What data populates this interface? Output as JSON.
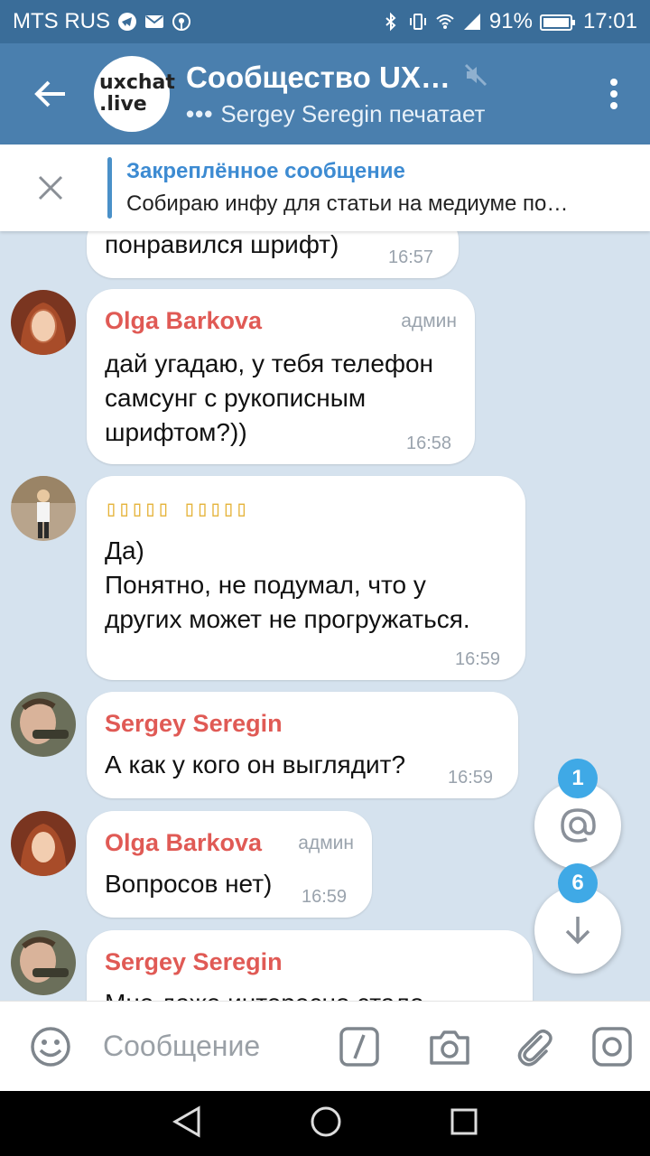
{
  "status_bar": {
    "carrier": "MTS RUS",
    "battery": "91%",
    "time": "17:01"
  },
  "header": {
    "avatar_line1": "uxchat",
    "avatar_line2": ".live",
    "title": "Сообщество UX…",
    "typing_dots": "•••",
    "status": "Sergey Seregin печатает"
  },
  "pinned": {
    "title": "Закреплённое сообщение",
    "message": "Собираю инфу для статьи на медиуме по…"
  },
  "messages": [
    {
      "text": "понравился шрифт)",
      "time": "16:57"
    },
    {
      "name": "Olga Barkova",
      "role": "админ",
      "lines": [
        "дай угадаю, у тебя телефон",
        "самсунг с рукописным",
        "шрифтом?))"
      ],
      "time": "16:58"
    },
    {
      "name": "▯▯▯▯▯ ▯▯▯▯▯",
      "lines": [
        "Да)",
        "Понятно, не подумал, что у",
        "других может не прогружаться."
      ],
      "time": "16:59"
    },
    {
      "name": "Sergey Seregin",
      "text": "А как у кого он выглядит?",
      "time": "16:59"
    },
    {
      "name": "Olga Barkova",
      "role": "админ",
      "text": "Вопросов нет)",
      "time": "16:59"
    },
    {
      "name": "Sergey Seregin",
      "text": "Мне даже интересно стало"
    }
  ],
  "fabs": {
    "mention_badge": "1",
    "scroll_badge": "6"
  },
  "input": {
    "placeholder": "Сообщение"
  },
  "colors": {
    "header": "#4a7fae",
    "status_bar": "#3a6d99",
    "name": "#e05a55",
    "accent": "#3fa9e6"
  }
}
